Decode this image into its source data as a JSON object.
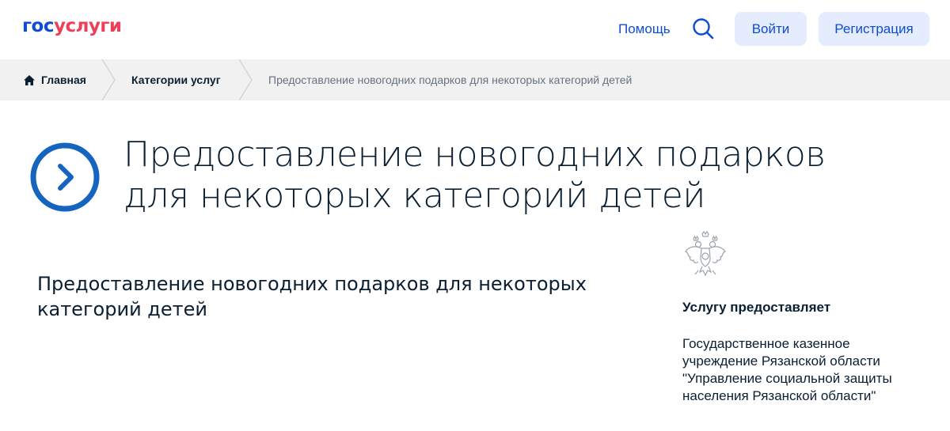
{
  "header": {
    "logo_part1": "гос",
    "logo_part2": "услуги",
    "help_label": "Помощь",
    "search_icon": "search-icon",
    "login_label": "Войти",
    "register_label": "Регистрация"
  },
  "breadcrumbs": {
    "home_label": "Главная",
    "home_icon": "home-icon",
    "categories_label": "Категории услуг",
    "current_label": "Предоставление новогодних подарков для некоторых категорий детей"
  },
  "hero": {
    "icon": "arrow-right-circle-icon",
    "title": "Предоставление новогодних подарков для некоторых категорий детей"
  },
  "service": {
    "title": "Предоставление новогодних подарков для некоторых категорий детей"
  },
  "provider": {
    "emblem_icon": "coat-of-arms-icon",
    "label": "Услугу предоставляет",
    "name": "Государственное казенное учреждение Рязанской области \"Управление социальной защиты населения Рязанской области\""
  },
  "colors": {
    "brand_blue": "#0d4cd3",
    "brand_red": "#ee3f58",
    "button_bg": "#e4ecfd",
    "breadcrumb_bg": "#f1f1f1",
    "hero_icon": "#1565c0"
  }
}
